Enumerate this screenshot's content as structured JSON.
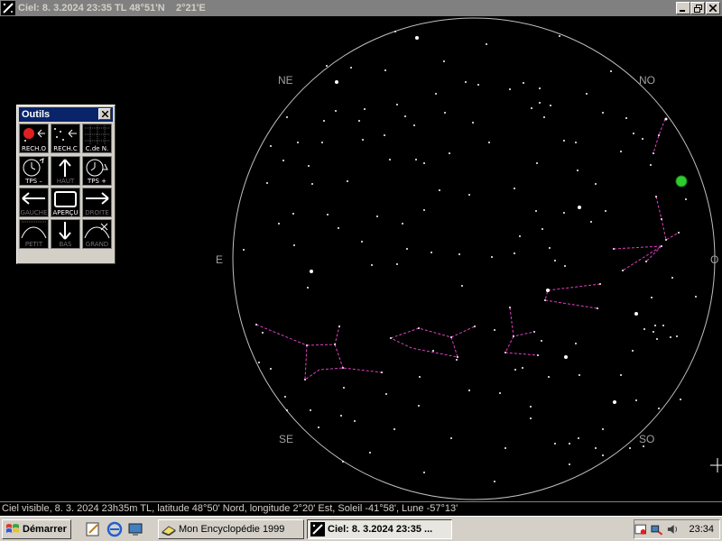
{
  "window": {
    "title": "Ciel: 8. 3.2024 23:35 TL 48°51'N    2°21'E",
    "minimize_icon": "minimize-icon",
    "maximize_icon": "restore-icon",
    "close_icon": "close-icon"
  },
  "sky": {
    "cardinals": {
      "ne": "NE",
      "no": "NO",
      "e": "E",
      "o": "O",
      "se": "SE",
      "so": "SO"
    },
    "constellation_color": "#e040c0",
    "horizon_color": "#c0c0c0",
    "planet_color": "#2ecc2e",
    "moon_color": "#e02020"
  },
  "tools": {
    "title": "Outils",
    "items": [
      {
        "label": "RECH.O",
        "icon": "find-object-icon",
        "enabled": true
      },
      {
        "label": "RECH.C",
        "icon": "find-constellation-icon",
        "enabled": true
      },
      {
        "label": "C.de N.",
        "icon": "star-map-icon",
        "enabled": true
      },
      {
        "label": "TPS –",
        "icon": "time-back-icon",
        "enabled": true
      },
      {
        "label": "HAUT",
        "icon": "arrow-up-icon",
        "enabled": false
      },
      {
        "label": "TPS +",
        "icon": "time-forward-icon",
        "enabled": true
      },
      {
        "label": "GAUCHE",
        "icon": "arrow-left-icon",
        "enabled": false
      },
      {
        "label": "APERÇU",
        "icon": "preview-icon",
        "enabled": true
      },
      {
        "label": "DROITE",
        "icon": "arrow-right-icon",
        "enabled": false
      },
      {
        "label": "PETIT",
        "icon": "zoom-out-icon",
        "enabled": false
      },
      {
        "label": "BAS",
        "icon": "arrow-down-icon",
        "enabled": false
      },
      {
        "label": "GRAND",
        "icon": "zoom-in-icon",
        "enabled": false
      }
    ]
  },
  "status": {
    "text": "Ciel visible, 8. 3. 2024 23h35m TL, latitude 48°50' Nord, longitude 2°20' Est, Soleil -41°58', Lune -57°13'"
  },
  "taskbar": {
    "start_label": "Démarrer",
    "tasks": [
      {
        "label": "Mon Encyclopédie 1999",
        "active": false
      },
      {
        "label": "Ciel: 8. 3.2024 23:35 ...",
        "active": true
      }
    ],
    "clock": "23:34"
  }
}
